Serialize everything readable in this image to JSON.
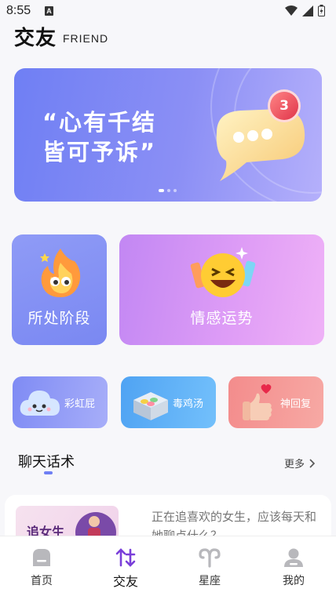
{
  "status_bar": {
    "time": "8:55",
    "notification_badge": "A"
  },
  "header": {
    "title": "交友",
    "subtitle": "FRIEND"
  },
  "banner": {
    "line1": "“心有千结",
    "line2": "皆可予诉”",
    "badge_count": "3",
    "slides": 3,
    "active_slide": 1
  },
  "features": {
    "stage": {
      "label": "所处阶段",
      "icon": "fire-mascot-icon"
    },
    "emotion": {
      "label": "情感运势",
      "icon": "laughing-emoji-icon"
    }
  },
  "tools": [
    {
      "label": "彩虹屁",
      "icon": "cloud-mascot-icon"
    },
    {
      "label": "毒鸡汤",
      "icon": "pill-box-icon"
    },
    {
      "label": "神回复",
      "icon": "thumbs-up-icon"
    }
  ],
  "section": {
    "title": "聊天话术",
    "more_label": "更多"
  },
  "article": {
    "text": "正在追喜欢的女生，应该每天和她聊点什么？",
    "thumb_text": "追女生"
  },
  "tabs": [
    {
      "label": "首页",
      "icon": "home-icon"
    },
    {
      "label": "交友",
      "icon": "friend-icon"
    },
    {
      "label": "星座",
      "icon": "aries-icon"
    },
    {
      "label": "我的",
      "icon": "profile-icon"
    }
  ],
  "active_tab": 1,
  "colors": {
    "accent": "#6f7ff4",
    "emotion_card": "#d996f5",
    "soup_card": "#5aaff5",
    "reply_card": "#f4959a"
  }
}
